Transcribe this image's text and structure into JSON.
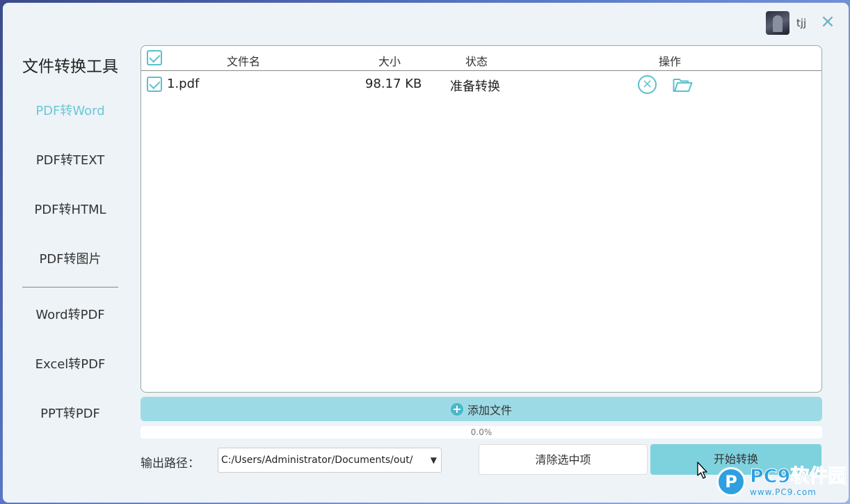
{
  "header": {
    "username": "tjj",
    "close_label": "×"
  },
  "sidebar": {
    "title": "文件转换工具",
    "group1": [
      {
        "label": "PDF转Word",
        "active": true
      },
      {
        "label": "PDF转TEXT"
      },
      {
        "label": "PDF转HTML"
      },
      {
        "label": "PDF转图片"
      }
    ],
    "group2": [
      {
        "label": "Word转PDF"
      },
      {
        "label": "Excel转PDF"
      },
      {
        "label": "PPT转PDF"
      }
    ]
  },
  "table": {
    "columns": {
      "name": "文件名",
      "size": "大小",
      "status": "状态",
      "actions": "操作"
    },
    "rows": [
      {
        "name": "1.pdf",
        "size": "98.17 KB",
        "status": "准备转换",
        "cancel": "×"
      }
    ]
  },
  "controls": {
    "add_label": "添加文件",
    "add_icon": "+",
    "progress_text": "0.0%",
    "progress_value": 0.0,
    "output_label": "输出路径：",
    "output_path": "C:/Users/Administrator/Documents/out/",
    "dropdown_arrow": "▼",
    "clear_label": "清除选中项",
    "start_label": "开始转换"
  },
  "watermark": {
    "logo": "P",
    "main": "PC9软件园",
    "sub": "www.PC9.com"
  },
  "colors": {
    "accent": "#6cc7d6",
    "button": "#7ed2de",
    "add_bar": "#9cdbe5"
  }
}
